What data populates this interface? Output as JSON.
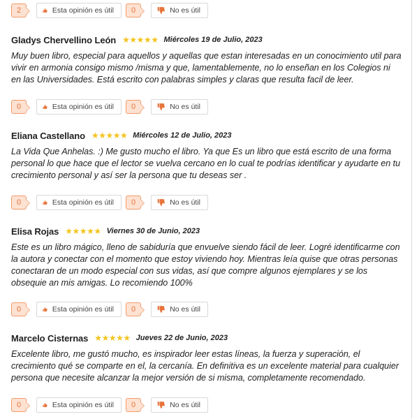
{
  "colors": {
    "accent": "#e8743b",
    "count_bg": "#fde2d2",
    "star": "#f3c41e"
  },
  "icons": {
    "helpful": "thumbs-up-icon",
    "not_helpful": "thumbs-down-icon",
    "rating": "star-icon"
  },
  "top_votes": {
    "helpful_count": "2",
    "helpful_label": "Esta opinión es útil",
    "not_helpful_count": "0",
    "not_helpful_label": "No es útil"
  },
  "reviews": [
    {
      "name": "Gladys Chervellino León",
      "rating": 5,
      "date": "Miércoles 19 de Julio, 2023",
      "text": "Muy buen libro, especial para aquellos y aquellas que estan interesadas en un conocimiento util para vivir en armonia consigo mismo /misma y que, lamentablemente, no lo enseñan en los Colegios ni en las Universidades. Está escrito con palabras simples y claras que resulta facil de leer.",
      "helpful_count": "0",
      "helpful_label": "Esta opinión es útil",
      "not_helpful_count": "0",
      "not_helpful_label": "No es útil"
    },
    {
      "name": "Eliana Castellano",
      "rating": 5,
      "date": "Miércoles 12 de Julio, 2023",
      "text": "La Vida Que Anhelas. :) Me gusto mucho el libro. Ya que Es un libro que está escrito de una forma personal lo que hace que el lector se vuelva cercano en lo cual te podrías identificar y ayudarte en tu crecimiento personal y así ser la persona que tu deseas ser .",
      "helpful_count": "0",
      "helpful_label": "Esta opinión es útil",
      "not_helpful_count": "0",
      "not_helpful_label": "No es útil"
    },
    {
      "name": "Elisa Rojas",
      "rating": 5,
      "date": "Viernes 30 de Junio, 2023",
      "text": "Este es un libro mágico, lleno de sabiduría que envuelve siendo fácil de leer. Logré identificarme con la autora y conectar con el momento que estoy viviendo hoy. Mientras leía quise que otras personas conectaran de un modo especial con sus vidas, así que compre algunos ejemplares y se los obsequie an mis amigas. Lo recomiendo 100%",
      "helpful_count": "0",
      "helpful_label": "Esta opinión es útil",
      "not_helpful_count": "0",
      "not_helpful_label": "No es útil"
    },
    {
      "name": "Marcelo Cisternas",
      "rating": 5,
      "date": "Jueves 22 de Junio, 2023",
      "text": "Excelente libro, me gustó mucho, es inspirador leer estas líneas, la fuerza y superación, el crecimiento qué se comparte en el, la cercanía. En definitiva es un excelente material para cualquier persona que necesite alcanzar la mejor versión de si misma, completamente recomendado.",
      "helpful_count": "0",
      "helpful_label": "Esta opinión es útil",
      "not_helpful_count": "0",
      "not_helpful_label": "No es útil"
    }
  ]
}
